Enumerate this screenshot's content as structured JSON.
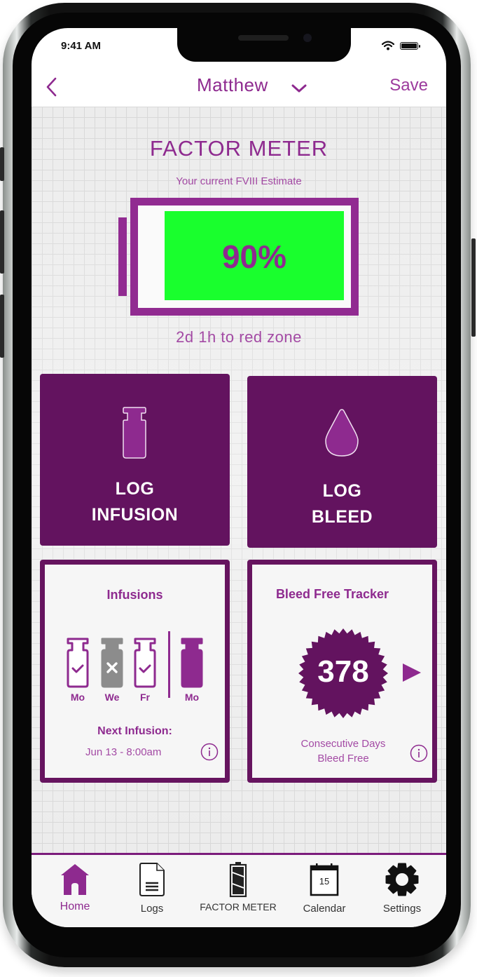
{
  "status_bar": {
    "time": "9:41 AM"
  },
  "navbar": {
    "title": "Matthew",
    "save_label": "Save"
  },
  "factor_meter": {
    "title": "FACTOR METER",
    "subtitle": "Your current FVIII Estimate",
    "percent_label": "90%",
    "level_fraction": 0.9,
    "time_to_red": "2d 1h to red zone",
    "fill_color": "#19ff2d"
  },
  "tiles": {
    "log_infusion": {
      "line1": "LOG",
      "line2": "INFUSION"
    },
    "log_bleed": {
      "line1": "LOG",
      "line2": "BLEED"
    }
  },
  "infusions_card": {
    "title": "Infusions",
    "history": [
      {
        "day": "Mo",
        "status": "done"
      },
      {
        "day": "We",
        "status": "missed"
      },
      {
        "day": "Fr",
        "status": "done"
      }
    ],
    "upcoming": {
      "day": "Mo",
      "status": "scheduled"
    },
    "next_label": "Next Infusion:",
    "next_value": "Jun 13 - 8:00am"
  },
  "bleed_card": {
    "title": "Bleed Free Tracker",
    "days": "378",
    "caption_line1": "Consecutive Days",
    "caption_line2": "Bleed Free"
  },
  "tabbar": {
    "items": [
      {
        "label": "Home",
        "icon": "home-icon",
        "active": true
      },
      {
        "label": "Logs",
        "icon": "document-icon",
        "active": false
      },
      {
        "label": "FACTOR METER",
        "icon": "battery-icon",
        "active": false
      },
      {
        "label": "Calendar",
        "icon": "calendar-icon",
        "active": false,
        "icon_text": "15"
      },
      {
        "label": "Settings",
        "icon": "gear-icon",
        "active": false
      }
    ]
  },
  "colors": {
    "brand_purple": "#8e2a8f",
    "tile_purple": "#63135f",
    "missed_gray": "#8c8c8c"
  }
}
